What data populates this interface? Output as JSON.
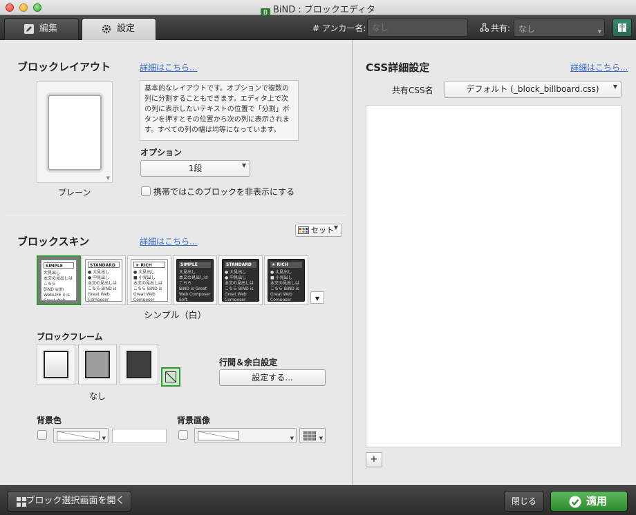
{
  "window": {
    "title": "BiND : ブロックエディタ",
    "app_icon_glyph": "B"
  },
  "toolbar": {
    "tabs": [
      {
        "label": "編集",
        "icon": "pencil-icon",
        "active": false
      },
      {
        "label": "設定",
        "icon": "gear-icon",
        "active": true
      }
    ],
    "anchor_label": "# アンカー名:",
    "anchor_placeholder": "なし",
    "share_label": "共有:",
    "share_value": "なし",
    "book_icon": "book-icon"
  },
  "block_layout": {
    "heading": "ブロックレイアウト",
    "details_link": "詳細はこちら...",
    "layout_name": "プレーン",
    "description": "基本的なレイアウトです。オプションで複数の列に分割することもできます。エディタ上で次の列に表示したいテキストの位置で「分割」ボタンを押すとその位置から次の列に表示されます。すべての列の幅は均等になっています。",
    "option_label": "オプション",
    "option_value": "1段",
    "hide_mobile_label": "携帯ではこのブロックを非表示にする",
    "hide_mobile_checked": false
  },
  "block_skin": {
    "heading": "ブロックスキン",
    "details_link": "詳細はこちら...",
    "set_button": "セット",
    "selected_name": "シンプル（白）",
    "skins": [
      {
        "title": "SIMPLE",
        "theme": "white",
        "lines": [
          "大見出し",
          "本文の見出しはこちら",
          "BiND with WebLIFE 3 is Great Web Composer Software of Japan"
        ]
      },
      {
        "title": "STANDARD",
        "theme": "white",
        "lines": [
          "● 大見出し",
          "● 中見出し",
          "本文の見出しはこちら BiND is Great Web Composer Soft."
        ]
      },
      {
        "title": "★ RICH",
        "theme": "white",
        "lines": [
          "● 大見出し",
          "■ 小見出し",
          "本文の見出しはこちら BiND is Great Web Composer Soft."
        ]
      },
      {
        "title": "SIMPLE",
        "theme": "dark",
        "lines": [
          "大見出し",
          "本文の見出しはこちら",
          "BiND is Great Web Composer Soft."
        ]
      },
      {
        "title": "STANDARD",
        "theme": "dark",
        "lines": [
          "● 大見出し",
          "● 中見出し",
          "本文の見出しはこちら BiND is Great Web Composer Soft."
        ]
      },
      {
        "title": "★ RICH",
        "theme": "dark",
        "lines": [
          "● 大見出し",
          "■ 小見出し",
          "本文の見出しはこちら BiND is Great Web Composer Soft."
        ]
      }
    ],
    "selected_index": 0
  },
  "block_frame": {
    "label": "ブロックフレーム",
    "selected_name": "なし",
    "frames": [
      "light",
      "gray",
      "dark",
      "none"
    ],
    "spacing_label": "行間＆余白設定",
    "spacing_button": "設定する..."
  },
  "background": {
    "color_label": "背景色",
    "image_label": "背景画像",
    "color_checked": false,
    "image_checked": false,
    "color_value": ""
  },
  "css": {
    "heading": "CSS詳細設定",
    "details_link": "詳細はこちら...",
    "shared_css_label": "共有CSS名",
    "shared_css_value": "デフォルト (_block_billboard.css)",
    "add_button": "+"
  },
  "bottom": {
    "open_selector": "ブロック選択画面を開く",
    "close": "閉じる",
    "apply": "適用"
  },
  "colors": {
    "accent_green": "#2f9a2f",
    "link_blue": "#3366cc",
    "toolbar_dark": "#333333"
  }
}
